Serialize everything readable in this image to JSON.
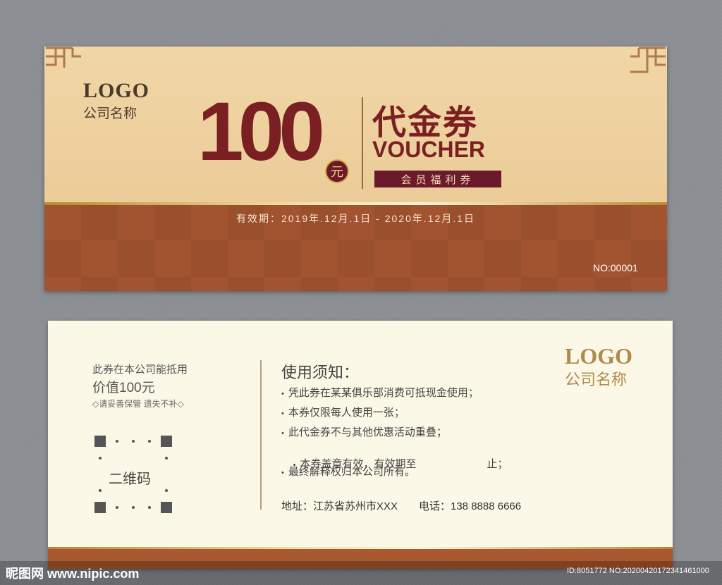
{
  "front": {
    "logo": "LOGO",
    "company": "公司名称",
    "amount": "100",
    "currency": "元",
    "title_cn": "代金券",
    "title_en": "VOUCHER",
    "member_label": "会员福利券",
    "validity": "有效期：2019年.12月.1日 - 2020年.12月.1日",
    "serial": "NO:00001"
  },
  "back": {
    "line1": "此券在本公司能抵用",
    "line2": "价值100元",
    "note": "◇请妥善保管 遗失不补◇",
    "qr_label": "二维码",
    "notice_title": "使用须知：",
    "bullet": "•",
    "notices": [
      "凭此券在某某俱乐部消费可抵现金使用；",
      "本券仅限每人使用一张；",
      "此代金券不与其他优惠活动重叠；",
      "本券盖章有效，有效期至                        止；",
      "最终解释权归本公司所有。"
    ],
    "address": "地址：江苏省苏州市XXX",
    "phone": "电话：138 8888 6666",
    "logo": "LOGO",
    "company": "公司名称"
  },
  "watermark": {
    "site": "昵图网 www.nipic.com",
    "id": "ID:8051772 NO:20200420172341461000"
  },
  "colors": {
    "front_top": "#ebcc98",
    "front_bottom": "#a2532f",
    "maroon": "#7a1f22",
    "gold": "#d9a94a",
    "back_bg": "#fcf8e8"
  }
}
